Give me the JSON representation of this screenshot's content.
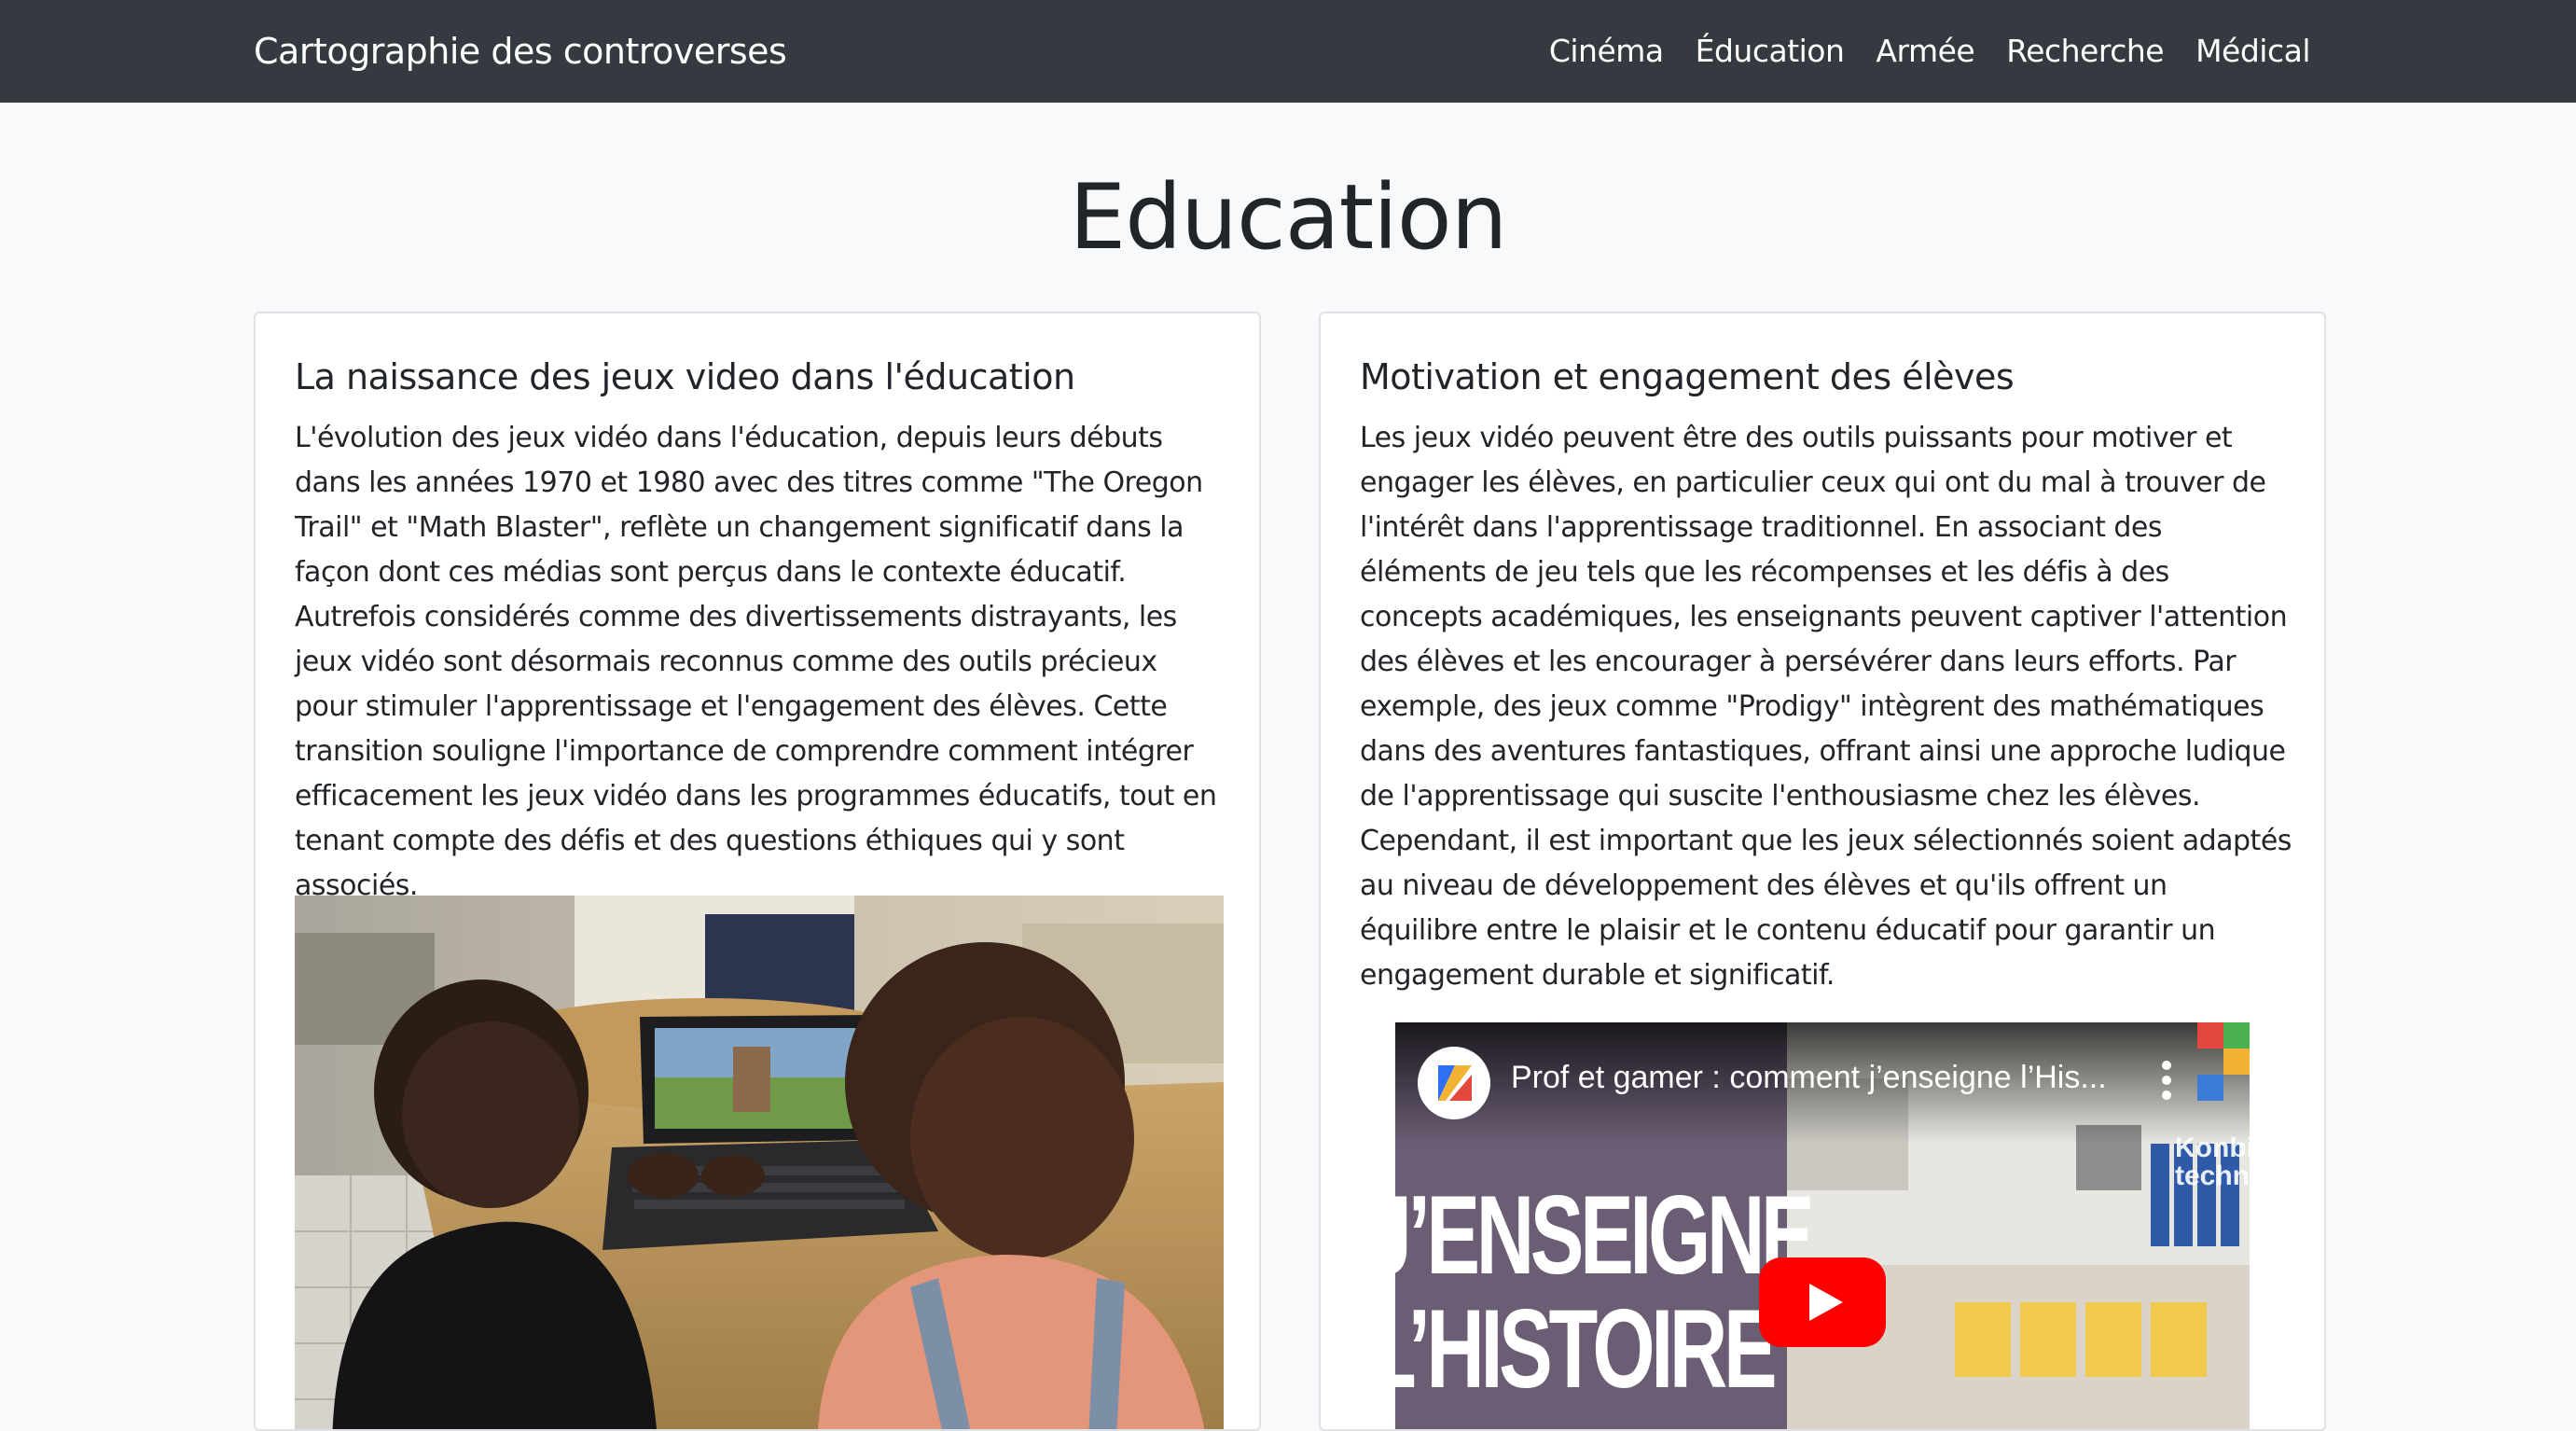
{
  "navbar": {
    "brand": "Cartographie des controverses",
    "links": [
      "Cinéma",
      "Éducation",
      "Armée",
      "Recherche",
      "Médical"
    ]
  },
  "page": {
    "title": "Education"
  },
  "cards": [
    {
      "title": "La naissance des jeux video dans l'éducation",
      "text": "L'évolution des jeux vidéo dans l'éducation, depuis leurs débuts dans les années 1970 et 1980 avec des titres comme \"The Oregon Trail\" et \"Math Blaster\", reflète un changement significatif dans la façon dont ces médias sont perçus dans le contexte éducatif. Autrefois considérés comme des divertissements distrayants, les jeux vidéo sont désormais reconnus comme des outils précieux pour stimuler l'apprentissage et l'engagement des élèves. Cette transition souligne l'importance de comprendre comment intégrer efficacement les jeux vidéo dans les programmes éducatifs, tout en tenant compte des défis et des questions éthiques qui y sont associés."
    },
    {
      "title": "Motivation et engagement des élèves",
      "text": "Les jeux vidéo peuvent être des outils puissants pour motiver et engager les élèves, en particulier ceux qui ont du mal à trouver de l'intérêt dans l'apprentissage traditionnel. En associant des éléments de jeu tels que les récompenses et les défis à des concepts académiques, les enseignants peuvent captiver l'attention des élèves et les encourager à persévérer dans leurs efforts. Par exemple, des jeux comme \"Prodigy\" intègrent des mathématiques dans des aventures fantastiques, offrant ainsi une approche ludique de l'apprentissage qui suscite l'enthousiasme chez les élèves. Cependant, il est important que les jeux sélectionnés soient adaptés au niveau de développement des élèves et qu'ils offrent un équilibre entre le plaisir et le contenu éducatif pour garantir un engagement durable et significatif."
    }
  ],
  "video": {
    "title": "Prof et gamer : comment j’enseigne l’His...",
    "overlay_line1": "J’ENSEIGNE",
    "overlay_line2": "L’HISTOIRE",
    "channel_text": "Konbini techno"
  },
  "colors": {
    "navbar_bg": "#343a40",
    "page_bg": "#f8f9fa",
    "youtube_red": "#ff0000"
  }
}
